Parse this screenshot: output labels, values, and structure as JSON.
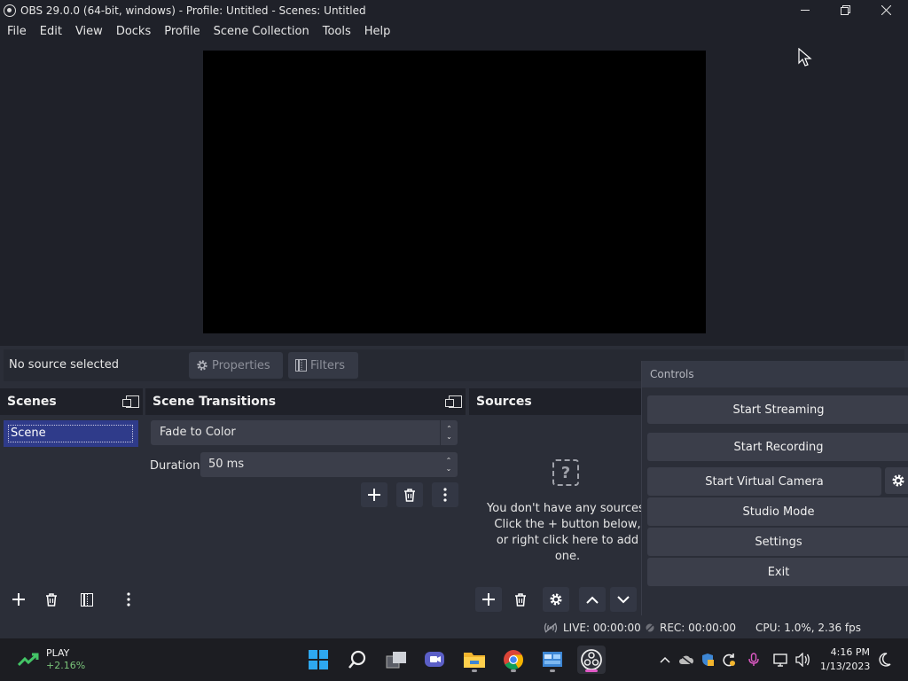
{
  "window": {
    "title": "OBS 29.0.0 (64-bit, windows) - Profile: Untitled - Scenes: Untitled",
    "minimize_icon": "minimize-icon",
    "maximize_icon": "restore-icon",
    "close_icon": "close-icon"
  },
  "menu": {
    "items": [
      "File",
      "Edit",
      "View",
      "Docks",
      "Profile",
      "Scene Collection",
      "Tools",
      "Help"
    ]
  },
  "context": {
    "no_source": "No source selected",
    "properties": "Properties",
    "filters": "Filters"
  },
  "scenes": {
    "title": "Scenes",
    "items": [
      "Scene"
    ]
  },
  "transitions": {
    "title": "Scene Transitions",
    "selected": "Fade to Color",
    "duration_label": "Duration",
    "duration_value": "50 ms"
  },
  "sources": {
    "title": "Sources",
    "empty_line1": "You don't have any sources.",
    "empty_line2": "Click the + button below,",
    "empty_line3": "or right click here to add one."
  },
  "controls": {
    "title": "Controls",
    "start_streaming": "Start Streaming",
    "start_recording": "Start Recording",
    "start_virtual_camera": "Start Virtual Camera",
    "studio_mode": "Studio Mode",
    "settings": "Settings",
    "exit": "Exit"
  },
  "status": {
    "live": "LIVE: 00:00:00",
    "rec": "REC: 00:00:00",
    "cpu": "CPU: 1.0%, 2.36 fps"
  },
  "taskbar": {
    "widget_label": "PLAY",
    "widget_change": "+2.16%",
    "time": "4:16 PM",
    "date": "1/13/2023"
  },
  "colors": {
    "accent_selected": "#2f3b8a",
    "panel_bg": "#2b2e38",
    "header_bg": "#1f2129",
    "button_bg": "#3b3e4a"
  }
}
